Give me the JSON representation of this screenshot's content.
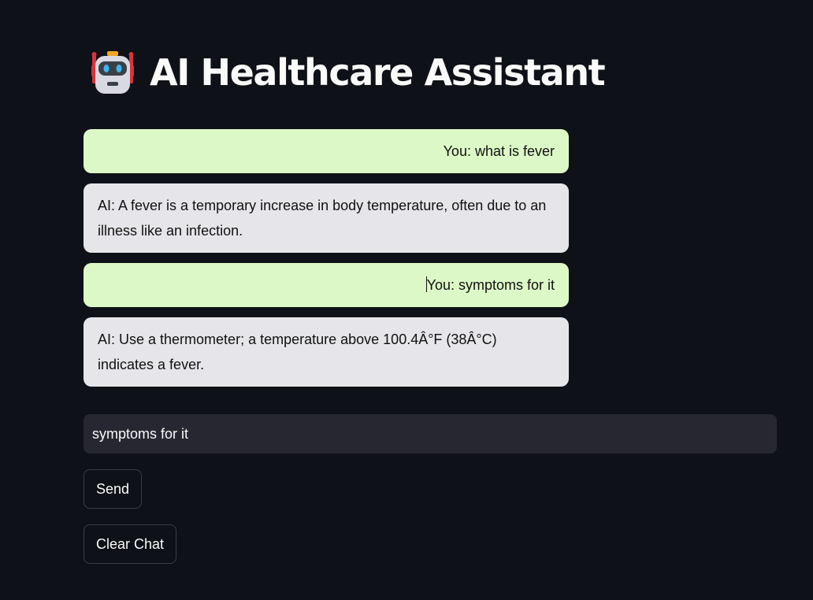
{
  "header": {
    "icon": "robot-icon",
    "title": "AI Healthcare Assistant"
  },
  "messages": [
    {
      "role": "user",
      "text": "You: what is fever"
    },
    {
      "role": "ai",
      "text": "AI: A fever is a temporary increase in body temperature, often due to an illness like an infection."
    },
    {
      "role": "user",
      "text": "You: symptoms for it"
    },
    {
      "role": "ai",
      "text": "AI: Use a thermometer; a temperature above 100.4Â°F (38Â°C) indicates a fever."
    }
  ],
  "input": {
    "value": "symptoms for it"
  },
  "buttons": {
    "send_label": "Send",
    "clear_label": "Clear Chat"
  },
  "colors": {
    "background": "#0e1117",
    "user_bubble": "#dcf8c6",
    "ai_bubble": "#e6e6ea",
    "input_bg": "#262730"
  }
}
